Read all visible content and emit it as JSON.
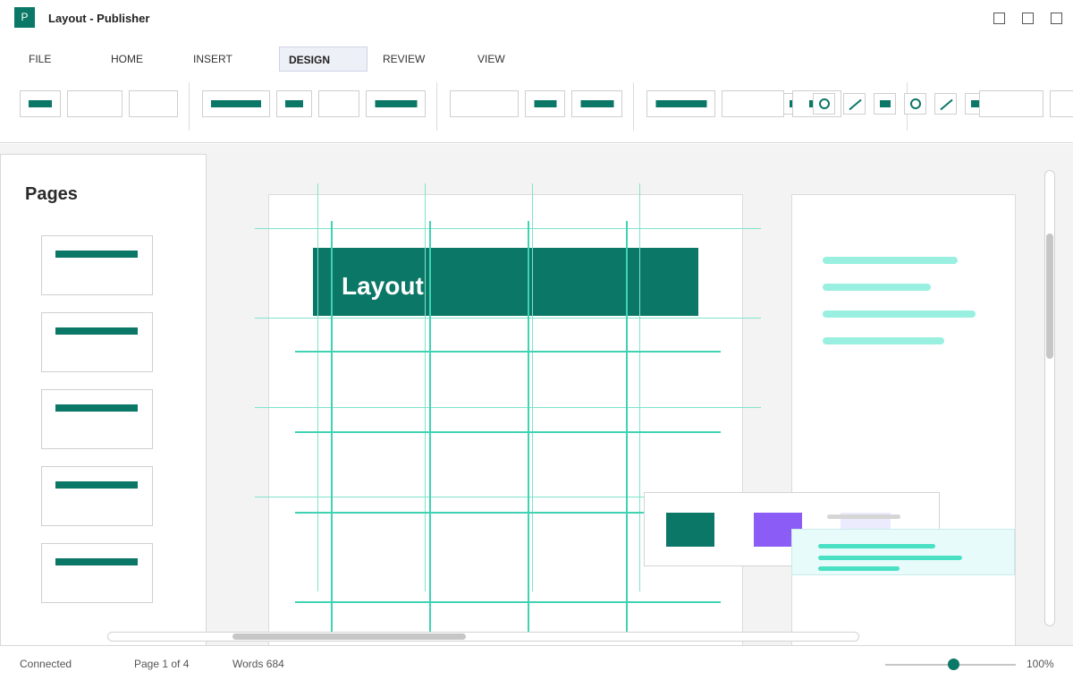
{
  "window": {
    "title": "Layout - Publisher",
    "app_icon_letter": "P"
  },
  "tabs": [
    {
      "label": "FILE",
      "active": false
    },
    {
      "label": "HOME",
      "active": false
    },
    {
      "label": "INSERT",
      "active": false
    },
    {
      "label": "DESIGN",
      "active": true
    },
    {
      "label": "REVIEW",
      "active": false
    },
    {
      "label": "VIEW",
      "active": false
    }
  ],
  "pages_panel": {
    "title": "Pages",
    "count": 5
  },
  "document": {
    "header_text": "Layout"
  },
  "status": {
    "connection": "Connected",
    "page": "Page 1 of 4",
    "words": "Words 684",
    "zoom": "100%",
    "zoom_level": 0.52
  },
  "colors": {
    "accent": "#0b7766",
    "guide": "#7fe3cc",
    "grid": "#3fd3b4",
    "text_placeholder": "#99f0e0",
    "purple": "#8b5cf6",
    "light": "#ecebfd"
  },
  "icons": [
    "app-icon",
    "minimize-icon",
    "maximize-icon",
    "close-icon",
    "rectangle-shape-icon",
    "circle-shape-icon",
    "line-shape-icon"
  ]
}
